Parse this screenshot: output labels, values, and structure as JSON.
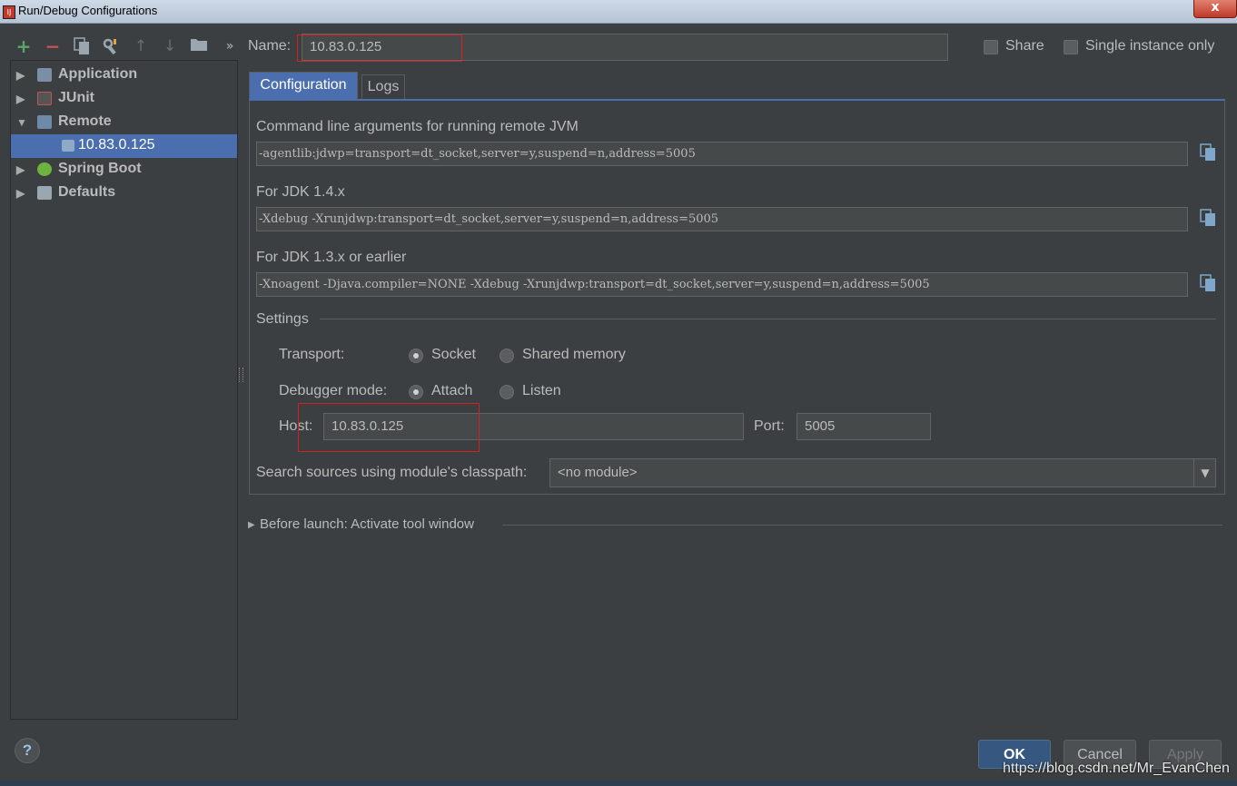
{
  "window": {
    "title": "Run/Debug Configurations",
    "close_label": "x"
  },
  "toolbar": {
    "more": "»"
  },
  "tree": {
    "items": [
      {
        "label": "Application",
        "expanded": false
      },
      {
        "label": "JUnit",
        "expanded": false
      },
      {
        "label": "Remote",
        "expanded": true
      },
      {
        "label": "10.83.0.125",
        "selected": true
      },
      {
        "label": "Spring Boot",
        "expanded": false
      },
      {
        "label": "Defaults",
        "expanded": false
      }
    ]
  },
  "name_field": {
    "label": "Name:",
    "value": "10.83.0.125"
  },
  "options": {
    "share_label": "Share",
    "single_instance_label": "Single instance only"
  },
  "tabs": [
    {
      "label": "Configuration",
      "active": true
    },
    {
      "label": "Logs",
      "active": false
    }
  ],
  "config": {
    "cmd_heading": "Command line arguments for running remote JVM",
    "cmd_value": "-agentlib:jdwp=transport=dt_socket,server=y,suspend=n,address=5005",
    "jdk14_heading": "For JDK 1.4.x",
    "jdk14_value": "-Xdebug -Xrunjdwp:transport=dt_socket,server=y,suspend=n,address=5005",
    "jdk13_heading": "For JDK 1.3.x or earlier",
    "jdk13_value": "-Xnoagent -Djava.compiler=NONE -Xdebug -Xrunjdwp:transport=dt_socket,server=y,suspend=n,address=5005",
    "settings_heading": "Settings",
    "transport_label": "Transport:",
    "transport_options": [
      "Socket",
      "Shared memory"
    ],
    "transport_selected": "Socket",
    "debugger_mode_label": "Debugger mode:",
    "debugger_mode_options": [
      "Attach",
      "Listen"
    ],
    "debugger_mode_selected": "Attach",
    "host_label": "Host:",
    "host_value": "10.83.0.125",
    "port_label": "Port:",
    "port_value": "5005",
    "module_label": "Search sources using module's classpath:",
    "module_value": "<no module>"
  },
  "before_launch": {
    "label": "Before launch: Activate tool window"
  },
  "footer": {
    "help_label": "?",
    "ok_label": "OK",
    "cancel_label": "Cancel",
    "apply_label": "Apply",
    "watermark": "https://blog.csdn.net/Mr_EvanChen"
  },
  "colors": {
    "background": "#3c3f41",
    "selection": "#4b6eaf",
    "highlight_box": "#d42020"
  }
}
